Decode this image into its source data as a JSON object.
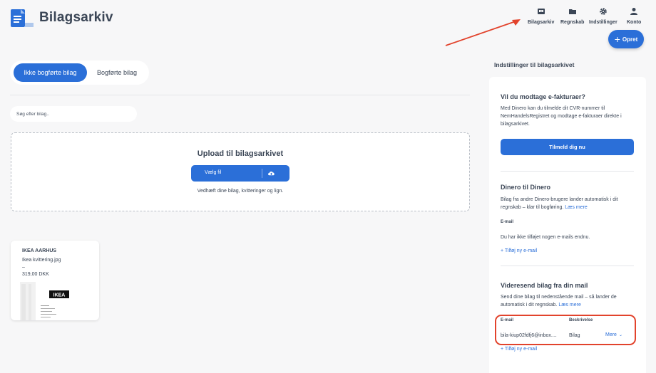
{
  "header": {
    "title": "Bilagsarkiv",
    "nav": [
      {
        "label": "Bilagsarkiv",
        "icon": "archive-icon"
      },
      {
        "label": "Regnskab",
        "icon": "folder-icon"
      },
      {
        "label": "Indstillinger",
        "icon": "gear-icon"
      },
      {
        "label": "Konto",
        "icon": "user-icon"
      }
    ],
    "create_label": "Opret"
  },
  "tabs": [
    {
      "label": "Ikke bogførte bilag",
      "active": true
    },
    {
      "label": "Bogførte bilag",
      "active": false
    }
  ],
  "search": {
    "placeholder": "Søg efter bilag.."
  },
  "upload": {
    "title": "Upload til bilagsarkivet",
    "button_label": "Vælg fil",
    "hint": "Vedhæft dine bilag, kvitteringer og lign."
  },
  "vouchers": [
    {
      "title": "IKEA AARHUS",
      "file": "Ikea kvittering.jpg",
      "dash": "–",
      "amount": "319,00 DKK",
      "logo_text": "IKEA"
    }
  ],
  "settings": {
    "heading": "Indstillinger til bilagsarkivet",
    "efaktura": {
      "title": "Vil du modtage e-fakturaer?",
      "text": "Med Dinero kan du tilmelde dit CVR-nummer til NemHandelsRegistret og modtage e-fakturaer direkte i bilagsarkivet.",
      "button_label": "Tilmeld dig nu"
    },
    "dinero": {
      "title": "Dinero til Dinero",
      "text": "Bilag fra andre Dinero-brugere lander automatisk i dit regnskab – klar til bogføring.",
      "link": "Læs mere",
      "email_label": "E-mail",
      "empty_text": "Du har ikke tilføjet nogen e-mails endnu.",
      "add_link": "+ Tilføj ny e-mail"
    },
    "forward": {
      "title": "Videresend bilag fra din mail",
      "text": "Send dine bilag til nedenstående mail – så lander de automatisk i dit regnskab.",
      "link": "Læs mere",
      "col_email": "E-mail",
      "col_desc": "Beskrivelse",
      "row_email": "bila-kiup02fdfj6@inbox....",
      "row_desc": "Bilag",
      "more_label": "Mere",
      "add_link": "+ Tilføj ny e-mail"
    }
  },
  "colors": {
    "accent": "#2b6fd8",
    "annotation": "#e2432c",
    "background": "#f7f7f8"
  }
}
